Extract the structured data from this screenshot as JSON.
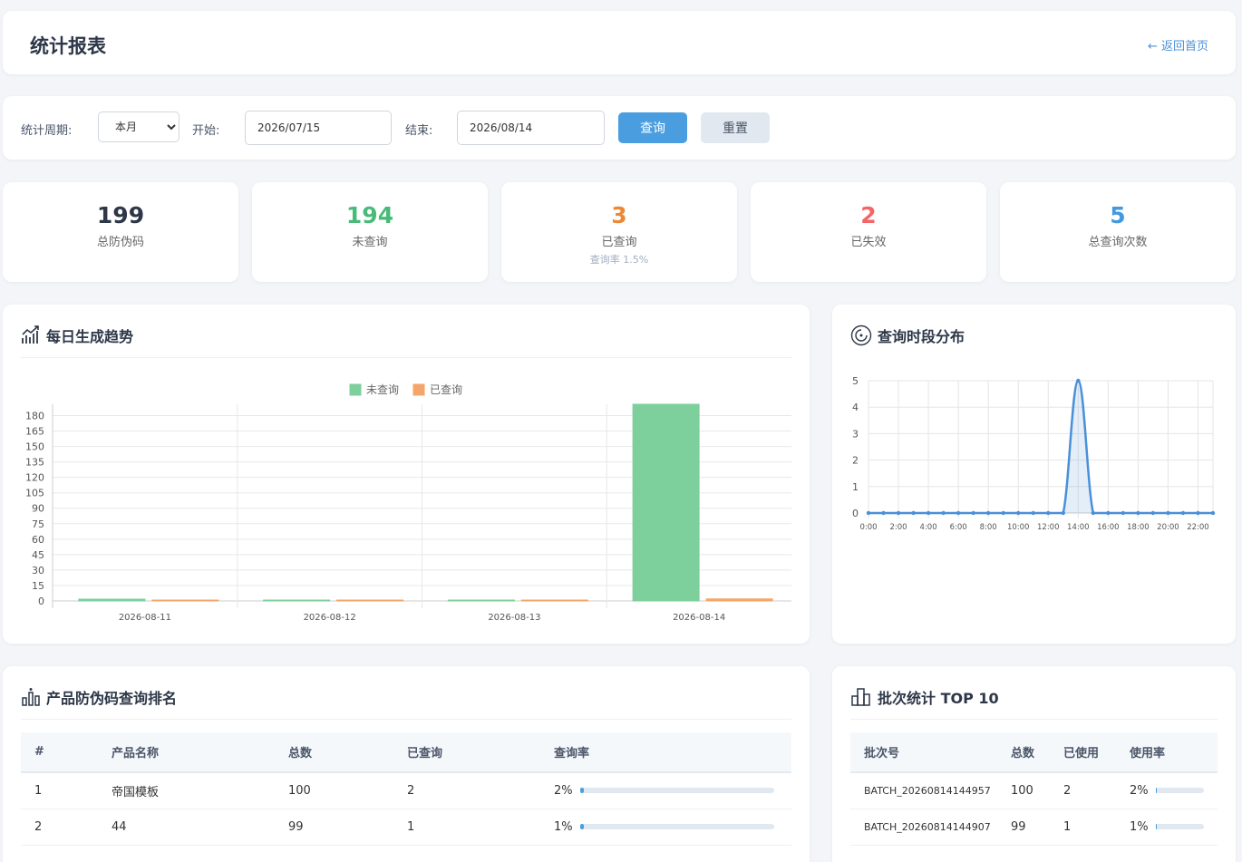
{
  "header": {
    "title": "统计报表",
    "back_link": "← 返回首页"
  },
  "filter": {
    "period_label": "统计周期:",
    "period_selected": "本月",
    "start_label": "开始:",
    "start_value": "2026/07/15",
    "end_label": "结束:",
    "end_value": "2026/08/14",
    "query_button": "查询",
    "reset_button": "重置"
  },
  "stats": [
    {
      "value": "199",
      "label": "总防伪码",
      "color": "#2d3748"
    },
    {
      "value": "194",
      "label": "未查询",
      "color": "#48bb78"
    },
    {
      "value": "3",
      "label": "已查询",
      "sub": "查询率 1.5%",
      "color": "#ed8936"
    },
    {
      "value": "2",
      "label": "已失效",
      "color": "#f56565"
    },
    {
      "value": "5",
      "label": "总查询次数",
      "color": "#4299e1"
    }
  ],
  "trend": {
    "title": "每日生成趋势",
    "icon": "chart-line-icon",
    "chart_data": {
      "type": "bar",
      "categories": [
        "2026-08-11",
        "2026-08-12",
        "2026-08-13",
        "2026-08-14"
      ],
      "series": [
        {
          "name": "未查询",
          "values": [
            1,
            0,
            0,
            191
          ],
          "color": "#7dcf9b"
        },
        {
          "name": "已查询",
          "values": [
            0,
            0,
            0,
            2
          ],
          "color": "#f4a66a"
        }
      ],
      "ylim": [
        0,
        191
      ],
      "yticks": [
        0,
        15,
        30,
        45,
        60,
        75,
        90,
        105,
        120,
        135,
        150,
        165,
        180
      ],
      "legend": "top"
    }
  },
  "hours": {
    "title": "查询时段分布",
    "icon": "clock-icon",
    "chart_data": {
      "type": "line",
      "x": [
        "0:00",
        "1:00",
        "2:00",
        "3:00",
        "4:00",
        "5:00",
        "6:00",
        "7:00",
        "8:00",
        "9:00",
        "10:00",
        "11:00",
        "12:00",
        "13:00",
        "14:00",
        "15:00",
        "16:00",
        "17:00",
        "18:00",
        "19:00",
        "20:00",
        "21:00",
        "22:00",
        "23:00"
      ],
      "xticks": [
        "0:00",
        "2:00",
        "4:00",
        "6:00",
        "8:00",
        "10:00",
        "12:00",
        "14:00",
        "16:00",
        "18:00",
        "20:00",
        "22:00"
      ],
      "values": [
        0,
        0,
        0,
        0,
        0,
        0,
        0,
        0,
        0,
        0,
        0,
        0,
        0,
        0,
        5,
        0,
        0,
        0,
        0,
        0,
        0,
        0,
        0,
        0
      ],
      "ylim": [
        0,
        5
      ],
      "yticks": [
        0,
        1,
        2,
        3,
        4,
        5
      ],
      "color": "#4a90d9"
    }
  },
  "ranking": {
    "title": "产品防伪码查询排名",
    "icon": "bar-chart-icon",
    "columns": [
      "#",
      "产品名称",
      "总数",
      "已查询",
      "查询率"
    ],
    "rows": [
      {
        "rank": "1",
        "name": "帝国模板",
        "total": "100",
        "queried": "2",
        "rate": "2%",
        "rate_value": 0.02
      },
      {
        "rank": "2",
        "name": "44",
        "total": "99",
        "queried": "1",
        "rate": "1%",
        "rate_value": 0.01
      }
    ]
  },
  "batch": {
    "title": "批次统计 TOP 10",
    "icon": "building-chart-icon",
    "columns": [
      "批次号",
      "总数",
      "已使用",
      "使用率"
    ],
    "rows": [
      {
        "batch": "BATCH_20260814144957",
        "total": "100",
        "used": "2",
        "rate": "2%",
        "rate_value": 0.02
      },
      {
        "batch": "BATCH_20260814144907",
        "total": "99",
        "used": "1",
        "rate": "1%",
        "rate_value": 0.01
      }
    ]
  }
}
